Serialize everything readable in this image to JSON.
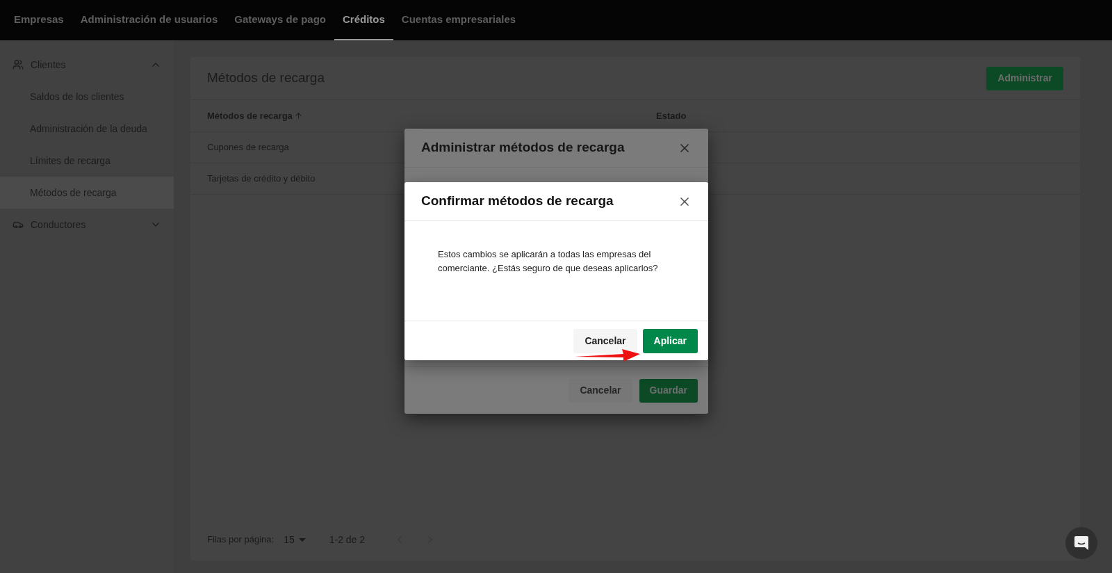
{
  "nav_tabs": [
    {
      "label": "Empresas",
      "selected": false
    },
    {
      "label": "Administración de usuarios",
      "selected": false
    },
    {
      "label": "Gateways de pago",
      "selected": false
    },
    {
      "label": "Créditos",
      "selected": true
    },
    {
      "label": "Cuentas empresariales",
      "selected": false
    }
  ],
  "sidebar": {
    "groups": [
      {
        "label": "Clientes",
        "kind": "people",
        "expanded": true,
        "children": [
          {
            "label": "Saldos de los clientes",
            "selected": false
          },
          {
            "label": "Administración de la deuda",
            "selected": false
          },
          {
            "label": "Límites de recarga",
            "selected": false
          },
          {
            "label": "Métodos de recarga",
            "selected": true
          }
        ]
      },
      {
        "label": "Conductores",
        "kind": "car",
        "expanded": false
      }
    ]
  },
  "card": {
    "title": "Métodos de recarga",
    "action": "Administrar",
    "table": {
      "columns": [
        {
          "label": "Métodos de recarga",
          "sorted": true
        },
        {
          "label": "Estado",
          "sorted": false
        }
      ],
      "rows": [
        {
          "name": "Cupones de recarga"
        },
        {
          "name": "Tarjetas de crédito y débito"
        }
      ]
    },
    "pagination": {
      "rows_label": "Filas por página:",
      "rows_value": "15",
      "range": "1-2 de 2"
    }
  },
  "manage_modal": {
    "title": "Administrar métodos de recarga",
    "cancel": "Cancelar",
    "save": "Guardar"
  },
  "confirm_modal": {
    "title": "Confirmar métodos de recarga",
    "message": "Estos cambios se aplicarán a todas las empresas del comerciante. ¿Estás seguro de que deseas aplicarlos?",
    "cancel": "Cancelar",
    "apply": "Aplicar"
  }
}
